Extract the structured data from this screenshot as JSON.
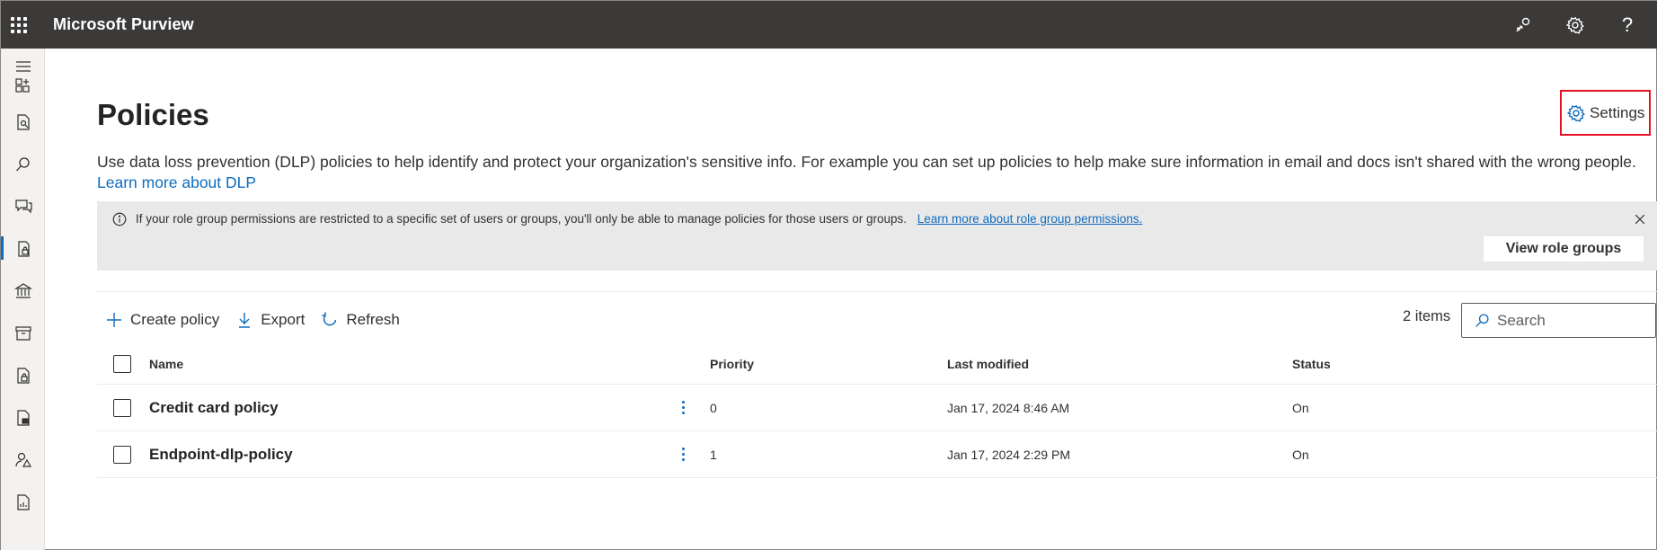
{
  "app": {
    "title": "Microsoft Purview"
  },
  "topbar": {
    "icons": [
      "feedback-icon",
      "gear-icon",
      "help-icon"
    ],
    "help_glyph": "?"
  },
  "leftrail": {
    "items": [
      "hamburger-menu-icon",
      "apps-icon",
      "report-icon",
      "search-icon",
      "communication-icon",
      "dlp-policy-icon",
      "bank-icon",
      "archive-icon",
      "lock-document-icon",
      "lock-file-icon",
      "user-warning-icon",
      "audit-icon"
    ],
    "active_index": 5
  },
  "page": {
    "title": "Policies",
    "settings_label": "Settings",
    "description": "Use data loss prevention (DLP) policies to help identify and protect your organization's sensitive info. For example you can set up policies to help make sure information in email and docs isn't shared with the wrong people.",
    "learn_more": "Learn more about DLP"
  },
  "banner": {
    "text": "If your role group permissions are restricted to a specific set of users or groups, you'll only be able to manage policies for those users or groups.",
    "link": "Learn more about role group permissions.",
    "button": "View role groups"
  },
  "toolbar": {
    "create": "Create policy",
    "export": "Export",
    "refresh": "Refresh",
    "count": "2 items",
    "search_placeholder": "Search"
  },
  "table": {
    "columns": {
      "name": "Name",
      "priority": "Priority",
      "modified": "Last modified",
      "status": "Status"
    },
    "rows": [
      {
        "name": "Credit card policy",
        "priority": "0",
        "modified": "Jan 17, 2024 8:46 AM",
        "status": "On"
      },
      {
        "name": "Endpoint-dlp-policy",
        "priority": "1",
        "modified": "Jan 17, 2024 2:29 PM",
        "status": "On"
      }
    ]
  },
  "colors": {
    "accent": "#0f6cbd",
    "topbar": "#3b3a39",
    "highlight": "#e81123"
  }
}
